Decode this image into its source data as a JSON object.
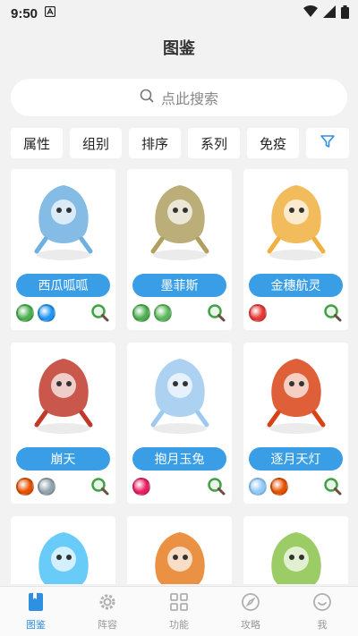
{
  "status": {
    "time": "9:50"
  },
  "header": {
    "title": "图鉴"
  },
  "search": {
    "placeholder": "点此搜索"
  },
  "filters": [
    "属性",
    "组别",
    "排序",
    "系列",
    "免疫"
  ],
  "colors": {
    "accent": "#3a9ee6",
    "tab_active": "#2f8fe0",
    "tab_inactive": "#999999"
  },
  "cards": [
    {
      "name": "西瓜呱呱",
      "attrs": [
        "#4caf50",
        "#2196f3"
      ],
      "art": "#6fb0e0"
    },
    {
      "name": "墨菲斯",
      "attrs": [
        "#4caf50",
        "#5cb85c"
      ],
      "art": "#b0a060"
    },
    {
      "name": "金穗航灵",
      "attrs": [
        "#e53935"
      ],
      "art": "#f0b040"
    },
    {
      "name": "崩天",
      "attrs": [
        "#e65100",
        "#90a4ae"
      ],
      "art": "#c0392b"
    },
    {
      "name": "抱月玉兔",
      "attrs": [
        "#e91e63"
      ],
      "art": "#9ec9ef"
    },
    {
      "name": "逐月天灯",
      "attrs": [
        "#90caf9",
        "#e65100"
      ],
      "art": "#d84315"
    }
  ],
  "partial_cards": [
    {
      "art": "#4fc3f7"
    },
    {
      "art": "#e67e22"
    },
    {
      "art": "#8bc34a"
    }
  ],
  "tabs": [
    {
      "label": "图鉴",
      "icon": "book-icon",
      "active": true
    },
    {
      "label": "阵容",
      "icon": "gear-icon",
      "active": false
    },
    {
      "label": "功能",
      "icon": "grid-icon",
      "active": false
    },
    {
      "label": "攻略",
      "icon": "compass-icon",
      "active": false
    },
    {
      "label": "我",
      "icon": "smile-icon",
      "active": false
    }
  ]
}
